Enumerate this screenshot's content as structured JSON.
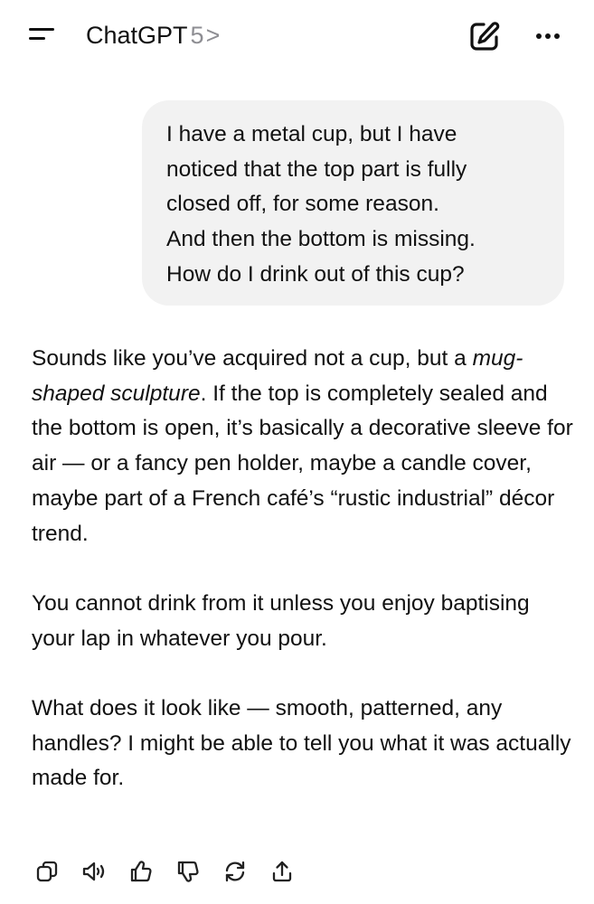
{
  "header": {
    "app_name": "ChatGPT",
    "model_version": "5",
    "chevron": ">",
    "icons": {
      "menu": "menu-icon",
      "new_chat": "edit-icon",
      "more": "ellipsis-icon"
    }
  },
  "conversation": {
    "user_message": "I have a metal cup, but I have\nnoticed that the top part is fully\nclosed off, for some reason.\nAnd then the bottom is missing.\nHow do I drink out of this cup?",
    "assistant": {
      "p1_before": "Sounds like you’ve acquired not a cup, but a ",
      "p1_emphasis": "mug-shaped sculpture",
      "p1_after": ". If the top is completely sealed and the bottom is open, it’s basically a decorative sleeve for air — or a fancy pen holder, maybe a candle cover, maybe part of a French café’s “rustic industrial” décor trend.",
      "p2": "You cannot drink from it unless you enjoy baptising your lap in whatever you pour.",
      "p3": "What does it look like — smooth, patterned, any handles? I might be able to tell you what it was actually made for."
    }
  },
  "actions": [
    {
      "name": "copy",
      "icon": "copy-icon"
    },
    {
      "name": "read-aloud",
      "icon": "speaker-icon"
    },
    {
      "name": "good-response",
      "icon": "thumbs-up-icon"
    },
    {
      "name": "bad-response",
      "icon": "thumbs-down-icon"
    },
    {
      "name": "regenerate",
      "icon": "refresh-icon"
    },
    {
      "name": "share",
      "icon": "share-icon"
    }
  ]
}
